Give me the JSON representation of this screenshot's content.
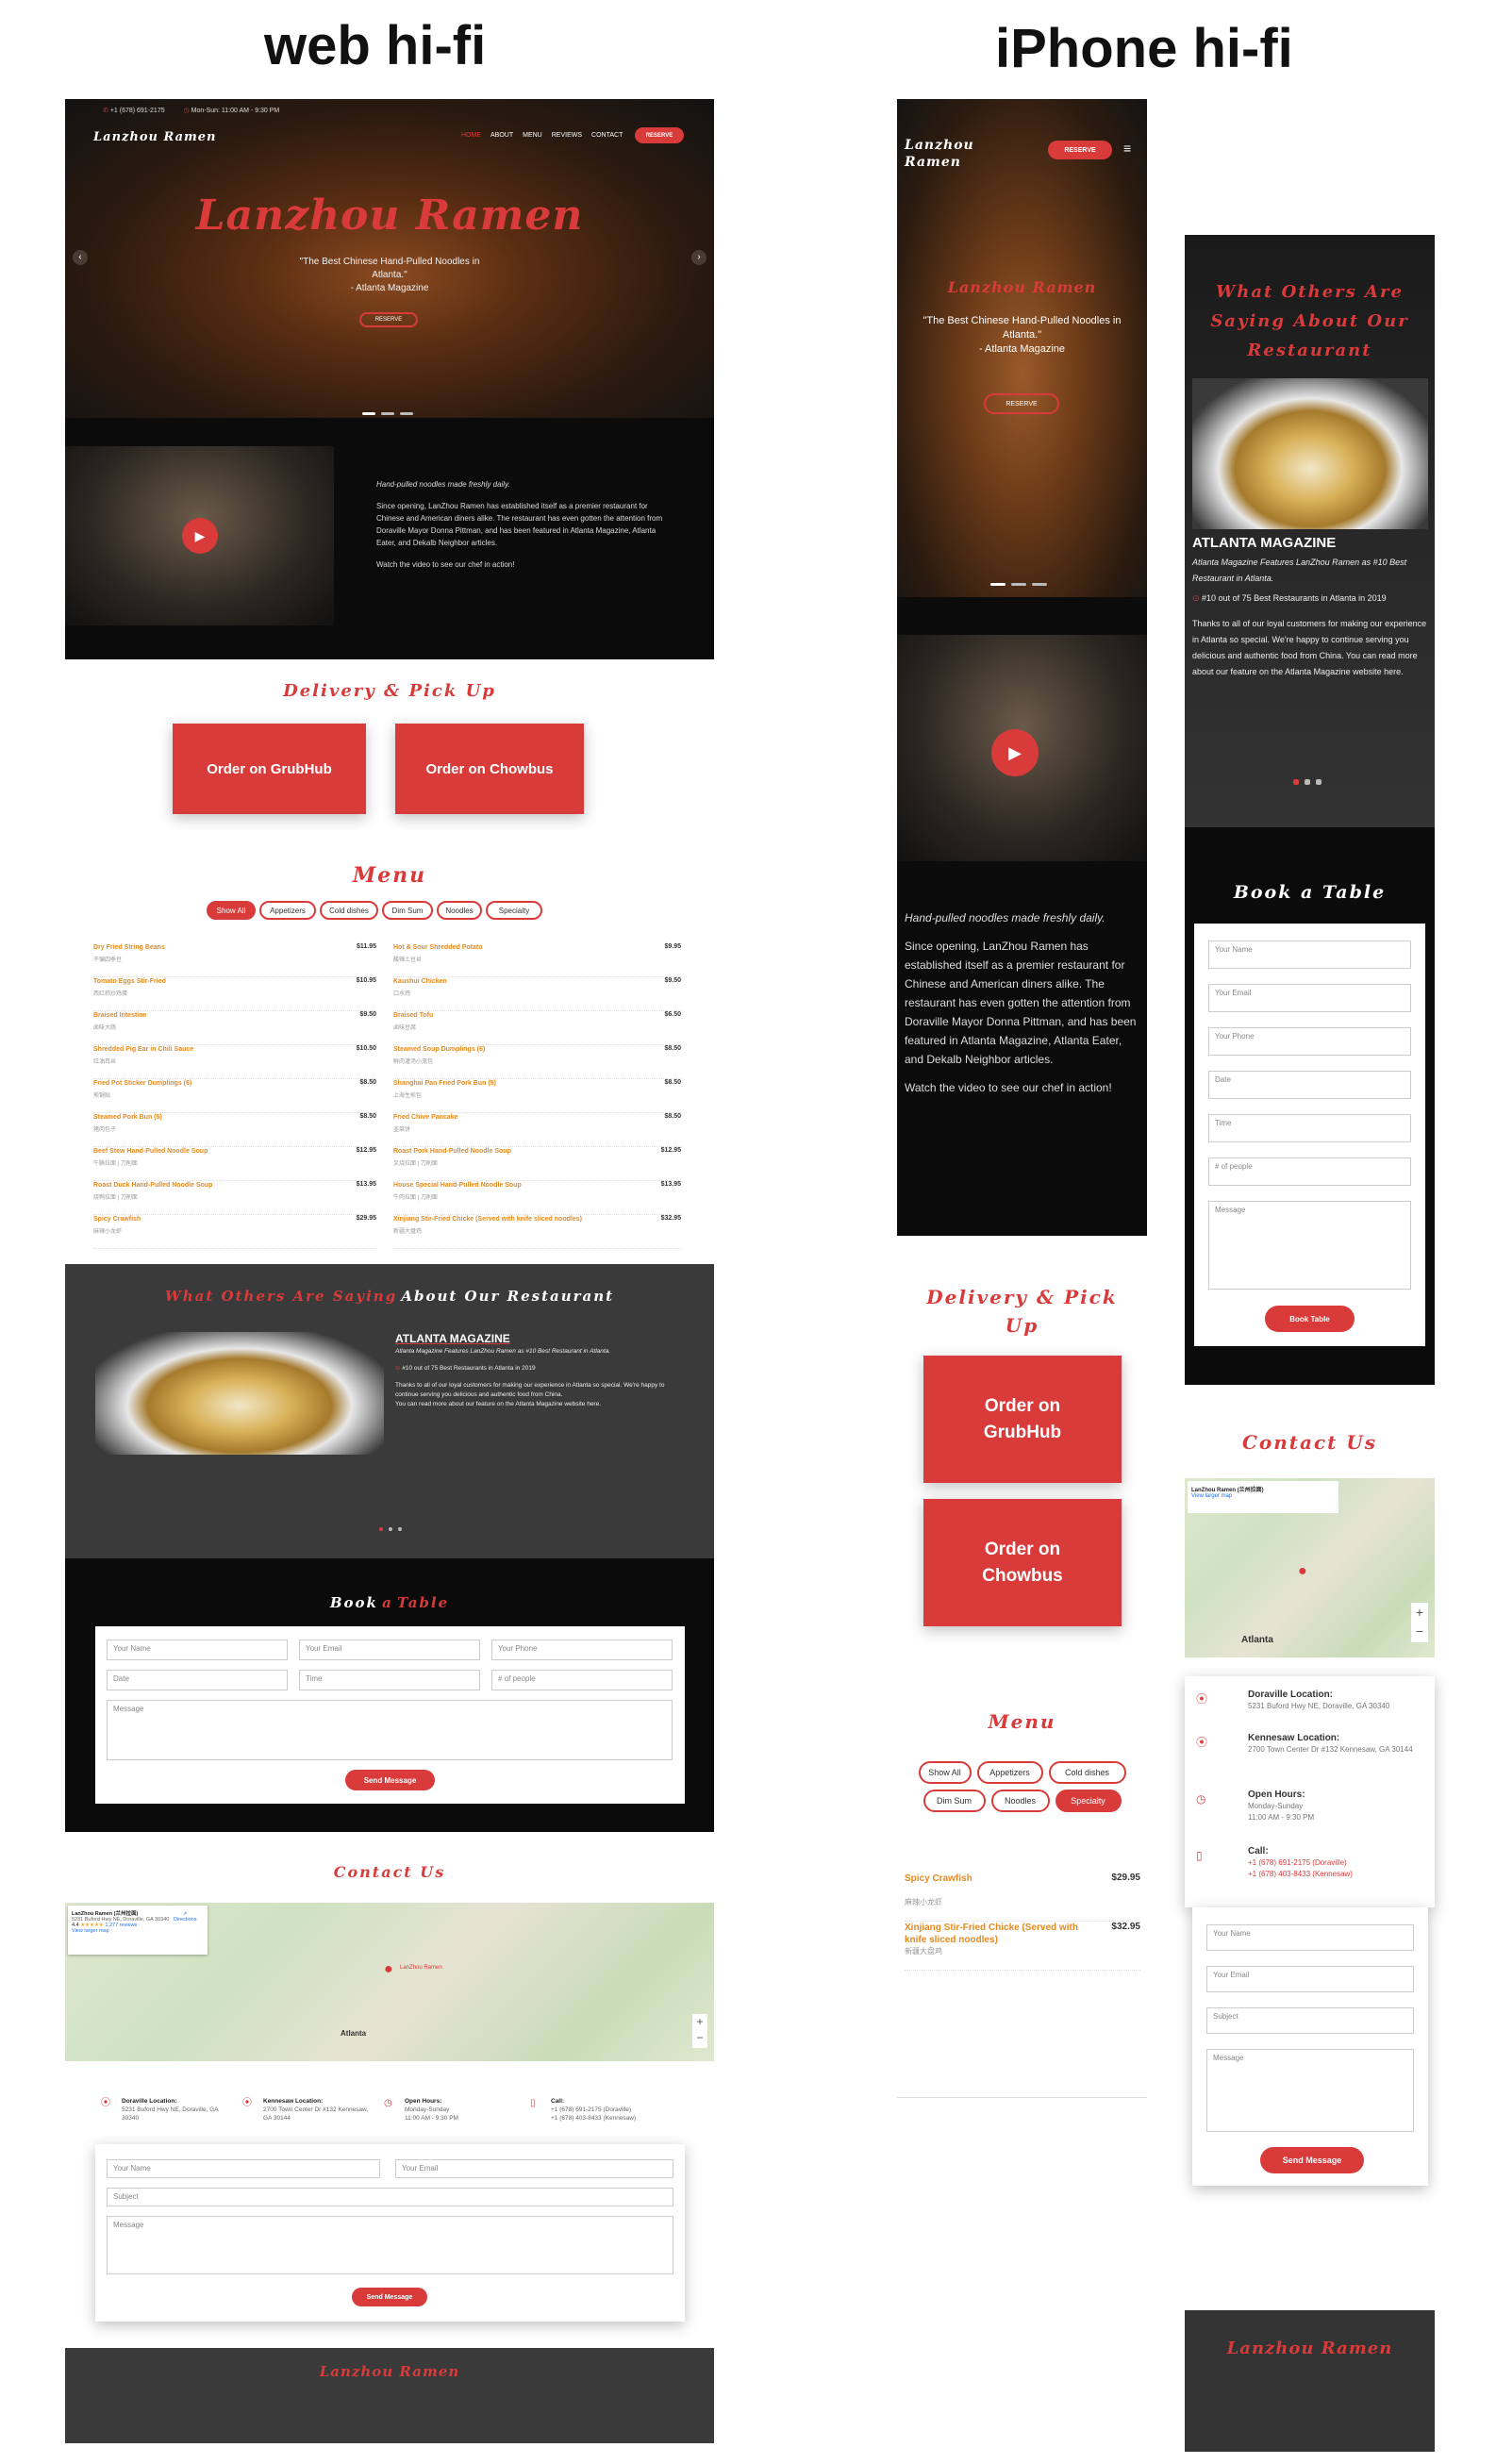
{
  "labels": {
    "web": "web hi-fi",
    "iphone": "iPhone hi-fi"
  },
  "brand": "Lanzhou Ramen",
  "web": {
    "topbar": {
      "phone": "+1 (678) 691-2175",
      "hours": "Mon-Sun: 11:00 AM - 9:30 PM"
    },
    "nav": {
      "items": [
        "HOME",
        "ABOUT",
        "MENU",
        "REVIEWS",
        "CONTACT"
      ],
      "reserve": "RESERVE"
    },
    "hero": {
      "title": "Lanzhou Ramen",
      "quote": "\"The Best Chinese Hand-Pulled Noodles in Atlanta.\"",
      "source": "- Atlanta Magazine",
      "button": "RESERVE"
    },
    "about": {
      "tagline": "Hand-pulled noodles made freshly daily.",
      "body": "Since opening, LanZhou Ramen has established itself as a premier restaurant for Chinese and American diners alike. The restaurant has even gotten the attention from Doraville Mayor Donna Pittman, and has been featured in Atlanta Magazine, Atlanta Eater, and Dekalb Neighbor articles.",
      "cta": "Watch the video to see our chef in action!"
    },
    "delivery": {
      "title": "Delivery & Pick Up",
      "grubhub": "Order on GrubHub",
      "chowbus": "Order on Chowbus"
    },
    "menu": {
      "title": "Menu",
      "filters": [
        "Show All",
        "Appetizers",
        "Cold dishes",
        "Dim Sum",
        "Noodles",
        "Specialty"
      ],
      "left": [
        {
          "name": "Dry Fried String Beans",
          "cn": "干煸四季豆",
          "price": "$11.95"
        },
        {
          "name": "Tomato Eggs Stir-Fried",
          "cn": "西红柿炒鸡蛋",
          "price": "$10.95"
        },
        {
          "name": "Braised Intestine",
          "cn": "卤味大肠",
          "price": "$9.50"
        },
        {
          "name": "Shredded Pig Ear in Chili Sauce",
          "cn": "红油耳丝",
          "price": "$10.50"
        },
        {
          "name": "Fried Pot Sticker Dumplings (6)",
          "cn": "煎锅贴",
          "price": "$8.50"
        },
        {
          "name": "Steamed Pork Bun (5)",
          "cn": "猪肉包子",
          "price": "$8.50"
        },
        {
          "name": "Beef Stew Hand-Pulled Noodle Soup",
          "cn": "牛腩拉面 | 刀削面",
          "price": "$12.95"
        },
        {
          "name": "Roast Duck Hand-Pulled Noodle Soup",
          "cn": "烧鸭拉面 | 刀削面",
          "price": "$13.95"
        },
        {
          "name": "Spicy Crawfish",
          "cn": "麻辣小龙虾",
          "price": "$29.95"
        }
      ],
      "right": [
        {
          "name": "Hot & Sour Shredded Potato",
          "cn": "酸辣土豆丝",
          "price": "$9.95"
        },
        {
          "name": "Kaushui Chicken",
          "cn": "口水鸡",
          "price": "$9.50"
        },
        {
          "name": "Braised Tofu",
          "cn": "卤味豆腐",
          "price": "$6.50"
        },
        {
          "name": "Steamed Soup Dumplings (6)",
          "cn": "鲜肉灌汤小笼包",
          "price": "$8.50"
        },
        {
          "name": "Shanghai Pan Fried Pork Bun (5)",
          "cn": "上海生煎包",
          "price": "$8.50"
        },
        {
          "name": "Fried Chive Pancake",
          "cn": "韭菜饼",
          "price": "$8.50"
        },
        {
          "name": "Roast Pork Hand-Pulled Noodle Soup",
          "cn": "叉烧拉面 | 刀削面",
          "price": "$12.95"
        },
        {
          "name": "House Special Hand-Pulled Noodle Soup",
          "cn": "牛肉拉面 | 刀削面",
          "price": "$13.95"
        },
        {
          "name": "Xinjiang Stir-Fried Chicke (Served with knife sliced noodles)",
          "cn": "新疆大盘鸡",
          "price": "$32.95"
        }
      ]
    },
    "reviews": {
      "title1": "What Others Are Saying",
      "title2": "About Our Restaurant",
      "source": "ATLANTA MAGAZINE",
      "feature": "Atlanta Magazine Features LanZhou Ramen as #10 Best Restaurant in Atlanta.",
      "rank": "#10 out of 75 Best Restaurants in Atlanta in 2019",
      "body": "Thanks to all of our loyal customers for making our experience in Atlanta so special. We're happy to continue serving you delicious and authentic food from China.",
      "more": "You can read more about our feature on the Atlanta Magazine website here."
    },
    "book": {
      "title1": "Book",
      "title2": "a",
      "title3": "Table",
      "name": "Your Name",
      "email": "Your Email",
      "phone": "Your Phone",
      "date": "Date",
      "time": "Time",
      "people": "# of people",
      "message": "Message",
      "submit": "Send Message"
    },
    "contact": {
      "title": "Contact Us",
      "map": {
        "place": "LanZhou Ramen (兰州拉面)",
        "addr": "5231 Buford Hwy NE, Doraville, GA 30340",
        "rating": "4.4",
        "reviews": "1,277 reviews",
        "larger": "View larger map",
        "directions": "Directions",
        "atlanta": "Atlanta",
        "pin": "LanZhou Ramen"
      },
      "doraville": {
        "label": "Doraville Location:",
        "addr": "5231 Buford Hwy NE, Doraville, GA 30340"
      },
      "kennesaw": {
        "label": "Kennesaw Location:",
        "addr": "2700 Town Center Dr #132 Kennesaw, GA 30144"
      },
      "hours": {
        "label": "Open Hours:",
        "days": "Monday-Sunday",
        "time": "11:00 AM - 9:30 PM"
      },
      "call": {
        "label": "Call:",
        "p1": "+1 (678) 691-2175 (Doraville)",
        "p2": "+1 (678) 403-8433 (Kennesaw)"
      },
      "form": {
        "name": "Your Name",
        "email": "Your Email",
        "subject": "Subject",
        "message": "Message",
        "submit": "Send Message"
      }
    },
    "footer": "Lanzhou Ramen"
  },
  "phone": {
    "reserve": "RESERVE",
    "hero": {
      "title": "Lanzhou Ramen",
      "quote": "\"The Best Chinese Hand-Pulled Noodles in Atlanta.\"",
      "source": "- Atlanta Magazine",
      "button": "RESERVE"
    },
    "about": {
      "tagline": "Hand-pulled noodles made freshly daily.",
      "body": "Since opening, LanZhou Ramen has established itself as a premier restaurant for Chinese and American diners alike. The restaurant has even gotten the attention from Doraville Mayor Donna Pittman, and has been featured in Atlanta Magazine, Atlanta Eater, and Dekalb Neighbor articles.",
      "cta": "Watch the video to see our chef in action!"
    },
    "delivery": {
      "title": "Delivery & Pick Up",
      "grubhub": "Order on GrubHub",
      "chowbus": "Order on Chowbus"
    },
    "menu": {
      "title": "Menu",
      "filters": [
        "Show All",
        "Appetizers",
        "Cold dishes",
        "Dim Sum",
        "Noodles",
        "Specialty"
      ],
      "items": [
        {
          "name": "Spicy Crawfish",
          "cn": "麻辣小龙虾",
          "price": "$29.95"
        },
        {
          "name": "Xinjiang Stir-Fried Chicke (Served with knife sliced noodles)",
          "cn": "新疆大盘鸡",
          "price": "$32.95"
        }
      ]
    },
    "reviews": {
      "title": "What Others Are Saying About Our Restaurant",
      "source": "ATLANTA MAGAZINE",
      "feature": "Atlanta Magazine Features LanZhou Ramen as #10 Best Restaurant in Atlanta.",
      "rank": "#10 out of 75 Best Restaurants in Atlanta in 2019",
      "body": "Thanks to all of our loyal customers for making our experience in Atlanta so special. We're happy to continue serving you delicious and authentic food from China. You can read more about our feature on the Atlanta Magazine website here."
    },
    "book": {
      "title": "Book a Table",
      "name": "Your Name",
      "email": "Your Email",
      "phone": "Your Phone",
      "date": "Date",
      "time": "Time",
      "people": "# of people",
      "message": "Message",
      "submit": "Book Table"
    },
    "contact": {
      "title": "Contact Us",
      "doraville": {
        "label": "Doraville Location:",
        "addr": "5231 Buford Hwy NE, Doraville, GA 30340"
      },
      "kennesaw": {
        "label": "Kennesaw Location:",
        "addr": "2700 Town Center Dr #132 Kennesaw, GA 30144"
      },
      "hours": {
        "label": "Open Hours:",
        "days": "Monday-Sunday",
        "time": "11:00 AM - 9:30 PM"
      },
      "call": {
        "label": "Call:",
        "p1": "+1 (678) 691-2175 (Doraville)",
        "p2": "+1 (678) 403-8433 (Kennesaw)"
      },
      "form": {
        "name": "Your Name",
        "email": "Your Email",
        "subject": "Subject",
        "message": "Message",
        "submit": "Send Message"
      }
    },
    "footer": "Lanzhou Ramen"
  },
  "colors": {
    "accent": "#d93a3a",
    "menu_orange": "#e58a1f",
    "dark": "#0b0b0b",
    "grey": "#3a3a3a"
  }
}
